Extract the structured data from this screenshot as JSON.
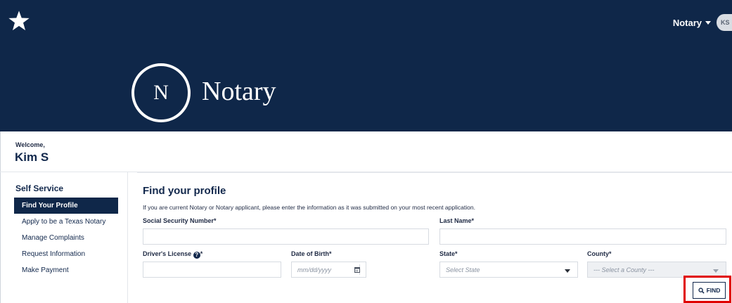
{
  "header": {
    "user_menu_label": "Notary",
    "avatar_initials": "KS",
    "logo_letter": "N",
    "logo_text": "Notary"
  },
  "welcome": {
    "label": "Welcome,",
    "name": "Kim S"
  },
  "sidebar": {
    "title": "Self Service",
    "items": [
      {
        "label": "Find Your Profile",
        "active": true
      },
      {
        "label": "Apply to be a Texas Notary",
        "active": false
      },
      {
        "label": "Manage Complaints",
        "active": false
      },
      {
        "label": "Request Information",
        "active": false
      },
      {
        "label": "Make Payment",
        "active": false
      }
    ]
  },
  "form": {
    "title": "Find your profile",
    "note": "If you are current Notary or Notary applicant, please enter the information as it was submitted on your most recent application.",
    "ssn_label": "Social Security Number",
    "last_name_label": "Last Name",
    "drivers_license_label": "Driver's License",
    "dob_label": "Date of Birth",
    "dob_placeholder": "mm/dd/yyyy",
    "state_label": "State",
    "state_placeholder": "Select State",
    "county_label": "County",
    "county_placeholder": "--- Select a County ---",
    "required_mark": "*",
    "find_button": "FIND"
  },
  "icons": {
    "logo": "star-icon",
    "help": "question-circle-icon",
    "calendar": "calendar-icon",
    "search": "search-icon"
  },
  "colors": {
    "header_bg": "#0f2749",
    "highlight": "#e00000"
  }
}
